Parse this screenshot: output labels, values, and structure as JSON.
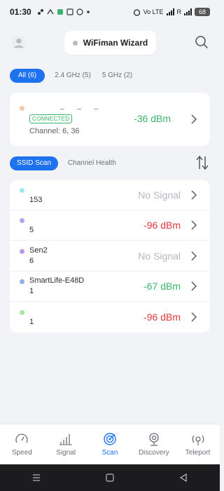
{
  "status_bar": {
    "time": "01:30",
    "network_tag": "Vo LTE",
    "sim_label": "R",
    "battery": "68"
  },
  "header": {
    "title": "WiFiman Wizard",
    "status_dot_color": "#b7bac0",
    "avatar_icon": "user-avatar-icon",
    "search_icon": "search-icon"
  },
  "band_filters": [
    {
      "label": "All (6)",
      "active": true
    },
    {
      "label": "2.4 GHz (5)",
      "active": false
    },
    {
      "label": "5 GHz (2)",
      "active": false
    }
  ],
  "connected": {
    "ssid": "_ _ _",
    "badge": "CONNECTED",
    "channel": "Channel: 6, 36",
    "signal": "-36 dBm",
    "dot_color": "#f3c9a6"
  },
  "view_tabs": [
    {
      "label": "SSID Scan",
      "active": true
    },
    {
      "label": "Channel Health",
      "active": false
    }
  ],
  "networks": [
    {
      "name": "",
      "sub": "153",
      "signal": "No Signal",
      "level": "none",
      "dot_color": "#9fe8f2"
    },
    {
      "name": "",
      "sub": "5",
      "signal": "-96 dBm",
      "level": "bad",
      "dot_color": "#a9a7ee"
    },
    {
      "name": "Sen2",
      "sub": "6",
      "signal": "No Signal",
      "level": "none",
      "dot_color": "#b79be6"
    },
    {
      "name": "SmartLife-E48D",
      "sub": "1",
      "signal": "-67 dBm",
      "level": "good",
      "dot_color": "#8fb0e8"
    },
    {
      "name": "",
      "sub": "1",
      "signal": "-96 dBm",
      "level": "bad",
      "dot_color": "#a6e8a0"
    }
  ],
  "bottom_nav": [
    {
      "label": "Speed",
      "icon": "speedometer-icon",
      "active": false
    },
    {
      "label": "Signal",
      "icon": "signal-bars-icon",
      "active": false
    },
    {
      "label": "Scan",
      "icon": "scan-radar-icon",
      "active": true
    },
    {
      "label": "Discovery",
      "icon": "discovery-icon",
      "active": false
    },
    {
      "label": "Teleport",
      "icon": "teleport-icon",
      "active": false
    }
  ],
  "colors": {
    "accent": "#1f72ee",
    "good": "#3bb36a",
    "bad": "#e0383e",
    "none": "#b5b8be"
  }
}
